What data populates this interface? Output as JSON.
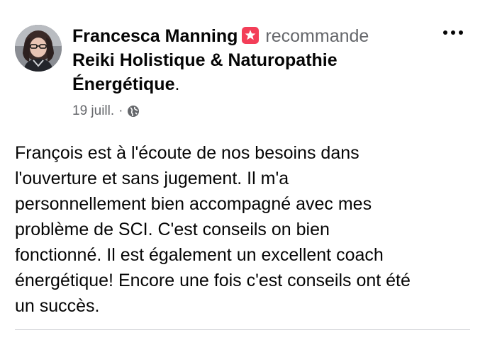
{
  "post": {
    "author": "Francesca Manning",
    "verb": "recommande",
    "page_name": "Reiki Holistique & Naturopathie Énergétique",
    "period": ".",
    "date": "19 juill.",
    "separator": "·",
    "privacy_icon": "globe-icon",
    "more_icon": "more-options-icon",
    "badge_icon": "recommend-star-icon",
    "badge_color": "#f33e58",
    "body": "François est à l'écoute de nos besoins dans\nl'ouverture et sans jugement. Il m'a\npersonnellement bien accompagné avec mes\nproblème de SCI. C'est conseils on bien\nfonctionné. Il est également un excellent coach\nénergétique! Encore une fois c'est conseils ont été\nun succès."
  },
  "colors": {
    "text_primary": "#050505",
    "text_secondary": "#65676b",
    "divider": "#ced0d4"
  }
}
